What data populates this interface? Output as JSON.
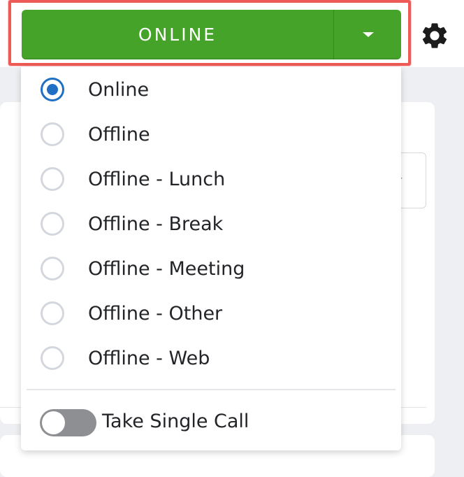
{
  "status_button": {
    "label": "ONLINE",
    "color": "#45a32a"
  },
  "settings": {
    "icon": "gear-icon"
  },
  "status_menu": {
    "selected": "Online",
    "items": [
      {
        "label": "Online",
        "checked": true
      },
      {
        "label": "Offline",
        "checked": false
      },
      {
        "label": "Offline - Lunch",
        "checked": false
      },
      {
        "label": "Offline - Break",
        "checked": false
      },
      {
        "label": "Offline - Meeting",
        "checked": false
      },
      {
        "label": "Offline - Other",
        "checked": false
      },
      {
        "label": "Offline - Web",
        "checked": false
      }
    ]
  },
  "single_call_toggle": {
    "label": "Take Single Call",
    "on": false
  },
  "colors": {
    "highlight": "#ee5a55",
    "radio_selected": "#1f6fc5"
  }
}
